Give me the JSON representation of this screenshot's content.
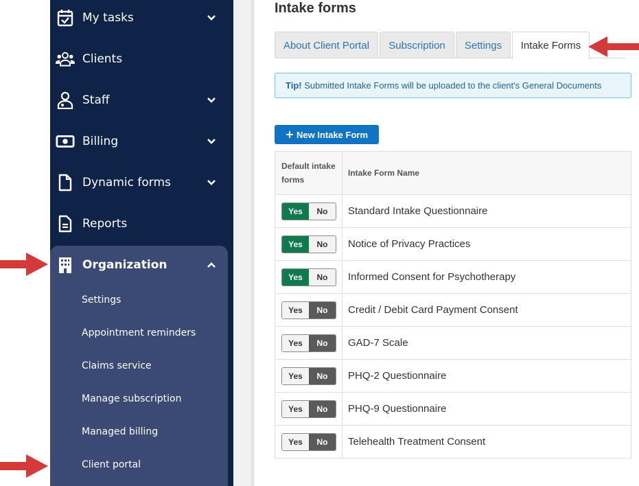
{
  "sidebar": {
    "items": [
      {
        "label": "My tasks",
        "icon": "calendar-check-icon",
        "chevron": "down"
      },
      {
        "label": "Clients",
        "icon": "users-icon",
        "chevron": ""
      },
      {
        "label": "Staff",
        "icon": "staff-icon",
        "chevron": "down"
      },
      {
        "label": "Billing",
        "icon": "money-icon",
        "chevron": "down"
      },
      {
        "label": "Dynamic forms",
        "icon": "document-icon",
        "chevron": "down"
      },
      {
        "label": "Reports",
        "icon": "report-icon",
        "chevron": ""
      },
      {
        "label": "Organization",
        "icon": "building-icon",
        "chevron": "up"
      }
    ],
    "org_submenu": [
      "Settings",
      "Appointment reminders",
      "Claims service",
      "Manage subscription",
      "Managed billing",
      "Client portal"
    ]
  },
  "main": {
    "title": "Intake forms",
    "tabs": [
      {
        "label": "About Client Portal",
        "active": false
      },
      {
        "label": "Subscription",
        "active": false
      },
      {
        "label": "Settings",
        "active": false
      },
      {
        "label": "Intake Forms",
        "active": true
      }
    ],
    "tip": {
      "prefix": "Tip!",
      "text": " Submitted Intake Forms will be uploaded to the client's General Documents"
    },
    "new_button": "New Intake Form",
    "table": {
      "headers": [
        "Default intake forms",
        "Intake Form Name"
      ],
      "rows": [
        {
          "default": "yes",
          "name": "Standard Intake Questionnaire"
        },
        {
          "default": "yes",
          "name": "Notice of Privacy Practices"
        },
        {
          "default": "yes",
          "name": "Informed Consent for Psychotherapy"
        },
        {
          "default": "no",
          "name": "Credit / Debit Card Payment Consent"
        },
        {
          "default": "no",
          "name": "GAD-7 Scale"
        },
        {
          "default": "no",
          "name": "PHQ-2 Questionnaire"
        },
        {
          "default": "no",
          "name": "PHQ-9 Questionnaire"
        },
        {
          "default": "no",
          "name": "Telehealth Treatment Consent"
        }
      ],
      "yes_label": "Yes",
      "no_label": "No"
    }
  },
  "colors": {
    "sidebar_bg": "#0e2347",
    "org_panel_bg": "#3a4a74",
    "yes_on": "#0f7a4e",
    "no_on": "#5a5a5a",
    "link": "#2a73b8",
    "primary_button": "#1173c4",
    "annotation_arrow": "#d43a3a"
  }
}
